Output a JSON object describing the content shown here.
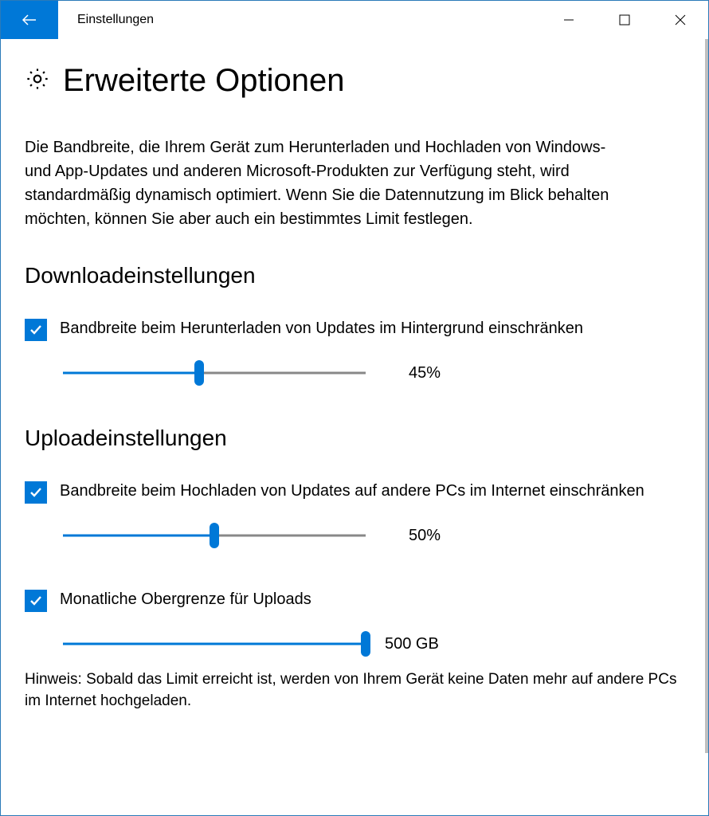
{
  "window": {
    "title": "Einstellungen"
  },
  "header": {
    "title": "Erweiterte Optionen"
  },
  "intro": "Die Bandbreite, die Ihrem Gerät zum Herunterladen und Hochladen von Windows- und App-Updates und anderen Microsoft-Produkten zur Verfügung steht, wird standardmäßig dynamisch optimiert. Wenn Sie die Datennutzung im Blick behalten möchten, können Sie aber auch ein bestimmtes Limit festlegen.",
  "download": {
    "section_title": "Downloadeinstellungen",
    "limit_label": "Bandbreite beim Herunterladen von Updates im Hintergrund einschränken",
    "limit_checked": true,
    "limit_percent": 45,
    "limit_value_text": "45%"
  },
  "upload": {
    "section_title": "Uploadeinstellungen",
    "limit_label": "Bandbreite beim Hochladen von Updates auf andere PCs im Internet einschränken",
    "limit_checked": true,
    "limit_percent": 50,
    "limit_value_text": "50%",
    "cap_label": "Monatliche Obergrenze für Uploads",
    "cap_checked": true,
    "cap_percent": 100,
    "cap_value_text": "500 GB"
  },
  "hint": "Hinweis: Sobald das Limit erreicht ist, werden von Ihrem Gerät keine Daten mehr auf andere PCs im Internet hochgeladen."
}
